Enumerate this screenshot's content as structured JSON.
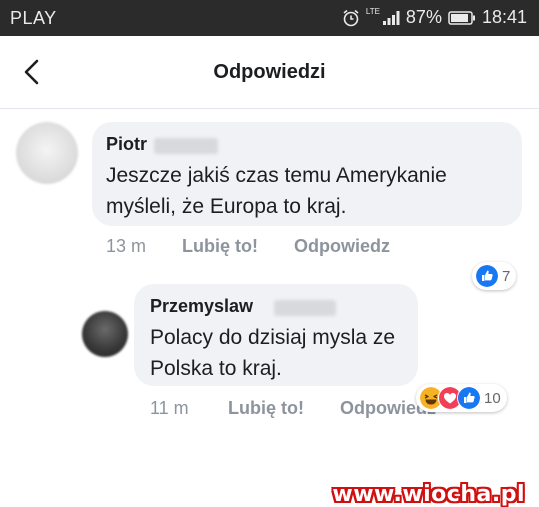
{
  "status_bar": {
    "carrier": "PLAY",
    "network_type": "LTE",
    "battery": "87%",
    "time": "18:41"
  },
  "header": {
    "title": "Odpowiedzi",
    "back_icon": "chevron-left-icon"
  },
  "comments": [
    {
      "author": "Piotr",
      "text": "Jeszcze jakiś czas temu Amerykanie myśleli, że Europa to kraj.",
      "time": "13 m",
      "like_label": "Lubię to!",
      "reply_label": "Odpowiedz",
      "reactions": [
        "like-icon"
      ],
      "reaction_count": "7"
    },
    {
      "author": "Przemyslaw",
      "text": "Polacy do dzisiaj mysla ze Polska to kraj.",
      "time": "11 m",
      "like_label": "Lubię to!",
      "reply_label": "Odpowiedz",
      "reactions": [
        "haha-icon",
        "love-icon",
        "like-icon"
      ],
      "reaction_count": "10"
    }
  ],
  "watermark": "www.wiocha.pl",
  "colors": {
    "status_bar_bg": "#2b2b2b",
    "bubble_bg": "#f0f2f5",
    "like_blue": "#1877f2",
    "love_red": "#f33e58",
    "haha_yellow": "#f7b125",
    "watermark_red": "#d01010"
  }
}
